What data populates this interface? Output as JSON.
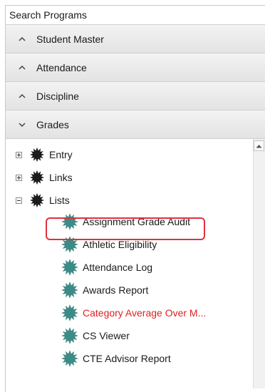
{
  "search": {
    "placeholder": "Search Programs"
  },
  "sections": [
    {
      "label": "Student Master",
      "state": "collapsed"
    },
    {
      "label": "Attendance",
      "state": "collapsed"
    },
    {
      "label": "Discipline",
      "state": "collapsed"
    },
    {
      "label": "Grades",
      "state": "expanded"
    }
  ],
  "tree": {
    "folders": [
      {
        "label": "Entry",
        "state": "collapsed"
      },
      {
        "label": "Links",
        "state": "collapsed"
      },
      {
        "label": "Lists",
        "state": "expanded"
      }
    ],
    "programs": [
      {
        "label": "Assignment Grade Audit",
        "color": "#1a1a1a"
      },
      {
        "label": "Athletic Eligibility",
        "color": "#1a1a1a",
        "highlighted": true
      },
      {
        "label": "Attendance Log",
        "color": "#1a1a1a"
      },
      {
        "label": "Awards Report",
        "color": "#1a1a1a"
      },
      {
        "label": "Category Average Over M...",
        "color": "#e02020"
      },
      {
        "label": "CS Viewer",
        "color": "#1a1a1a"
      },
      {
        "label": "CTE Advisor Report",
        "color": "#1a1a1a"
      }
    ]
  },
  "colors": {
    "highlight_border": "#e0303c",
    "warning_text": "#e02020",
    "program_gear": "#3d8a86",
    "folder_gear": "#1b1b1b"
  }
}
